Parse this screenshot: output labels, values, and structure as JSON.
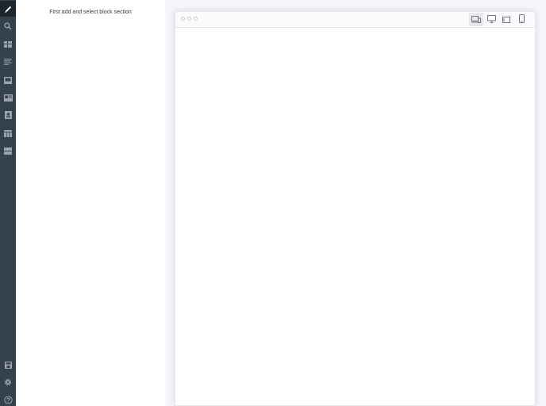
{
  "panel": {
    "message": "First add and select block section"
  },
  "rail": {
    "items": [
      {
        "icon": "pencil-icon",
        "active": true
      },
      {
        "icon": "search-icon"
      },
      {
        "icon": "grid-icon"
      },
      {
        "icon": "text-lines-icon"
      },
      {
        "icon": "image-icon"
      },
      {
        "icon": "media-card-icon"
      },
      {
        "icon": "contact-card-icon"
      },
      {
        "icon": "table-icon"
      },
      {
        "icon": "rows-icon"
      }
    ],
    "bottom_items": [
      {
        "icon": "save-icon"
      },
      {
        "icon": "gear-icon"
      },
      {
        "icon": "help-icon"
      }
    ]
  },
  "preview": {
    "devices": [
      {
        "icon": "laptop-tablet-icon",
        "selected": true
      },
      {
        "icon": "desktop-icon"
      },
      {
        "icon": "tablet-landscape-icon"
      },
      {
        "icon": "phone-icon"
      }
    ]
  },
  "colors": {
    "rail_bg": "#35414d",
    "rail_active_bg": "#1d252d",
    "icon_color": "#9aa5b1",
    "preview_bg": "#f6f6fa"
  }
}
